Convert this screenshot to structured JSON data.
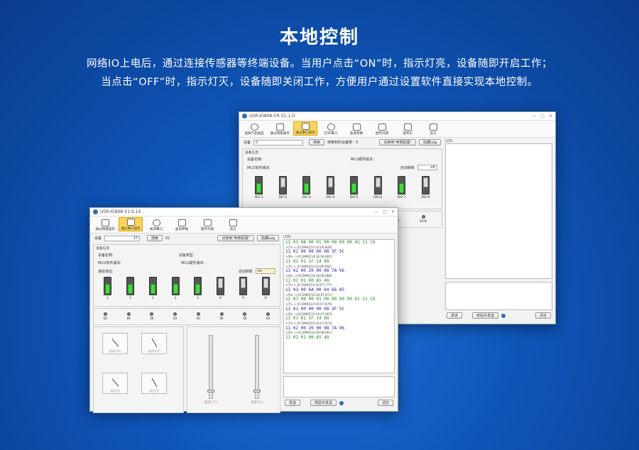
{
  "hero": {
    "title": "本地控制",
    "line1": "网络IO上电后，通过连接传感器等终端设备。当用户点击“ON”时，指示灯亮，设备随即开启工作；",
    "line2": "当点击“OFF”时，指示灯灭，设备随即关闭工作，方便用户通过设置软件直接实现本地控制。"
  },
  "back_window": {
    "title": "USR-IO808-CR V1.1.0",
    "toolbar": [
      {
        "label": "选择产品类型",
        "icon": "disc-icon"
      },
      {
        "label": "通过网络操作",
        "icon": "network-icon"
      },
      {
        "label": "通过串口操作",
        "icon": "serial-port-icon",
        "active": true
      },
      {
        "label": "打开串口",
        "icon": "plug-icon"
      },
      {
        "label": "查询参数",
        "icon": "query-icon"
      },
      {
        "label": "固件升级",
        "icon": "rocket-icon"
      },
      {
        "label": "透传云",
        "icon": "cloud-icon"
      },
      {
        "label": "语言",
        "icon": "globe-icon"
      }
    ],
    "device_label": "设备",
    "device_value": "0",
    "search_label": "搜索",
    "found_label": "搜索到的设备数：0",
    "switch_button": "切换到\"参数配置\"",
    "hide_log_button": "隐藏Log",
    "info_group": "设备信息",
    "device_name_label": "设备名称:",
    "mcu_label": "MCU硬件版本:",
    "mcu_fw_label": "MCU软件版本:",
    "auto_refresh_label": "自动刷新",
    "auto_refresh_value": "off",
    "relays": [
      {
        "label": "DO-1",
        "state": "on"
      },
      {
        "label": "DO-2",
        "state": "off"
      },
      {
        "label": "DO-3",
        "state": "on"
      },
      {
        "label": "DO-4",
        "state": "off"
      },
      {
        "label": "DO-5",
        "state": "on"
      },
      {
        "label": "DO-6",
        "state": "off"
      },
      {
        "label": "DO-7",
        "state": "on"
      },
      {
        "label": "DO-8",
        "state": "off"
      }
    ],
    "di_visible": [
      "DI-7",
      "DI-8"
    ],
    "log_title": "LOG",
    "send_button": "发送",
    "verify_send_button": "校验并发送",
    "clear_button": "清空"
  },
  "front_window": {
    "title": "USR-IO808 V1.0.14",
    "toolbar": [
      {
        "label": "通过网络操作",
        "icon": "network-icon"
      },
      {
        "label": "通过串口操作",
        "icon": "serial-port-icon",
        "active": true
      },
      {
        "label": "关闭串口",
        "icon": "check-icon"
      },
      {
        "label": "查询参数",
        "icon": "query-icon"
      },
      {
        "label": "固件升级",
        "icon": "rocket-icon"
      },
      {
        "label": "语言",
        "icon": "globe-icon"
      }
    ],
    "device_label": "设备",
    "device_value": "17",
    "search_label": "搜索",
    "found_value": "01",
    "switch_button": "切换到\"参数配置\"",
    "hide_log_button": "隐藏Log",
    "info_group": "设备信息",
    "device_name_label": "设备名称:",
    "device_type_label": "设备类型:",
    "mcu_fw_label": "MCU软件版本:",
    "mcu_hw_label": "MCU硬件版本:",
    "comm_addr_label": "通信地址:",
    "auto_refresh_label": "自动刷新",
    "auto_refresh_value": "on",
    "relays": [
      {
        "label": "1",
        "state": "on"
      },
      {
        "label": "1",
        "state": "on"
      },
      {
        "label": "1",
        "state": "on"
      },
      {
        "label": "1",
        "state": "on"
      },
      {
        "label": "1",
        "state": "on"
      },
      {
        "label": "0",
        "state": "off"
      },
      {
        "label": "0",
        "state": "off"
      },
      {
        "label": "0",
        "state": "off"
      }
    ],
    "di_labels": [
      "DI",
      "DI",
      "DI",
      "DI",
      "DI",
      "DI",
      "DI",
      "DI"
    ],
    "gauges": [
      "电流(mA)",
      "电流(mA)",
      "电压(V)",
      "电压(V)"
    ],
    "slider_labels": [
      "温度(°C)",
      "湿度(%)"
    ],
    "log_title": "LOG",
    "log_lines": [
      {
        "kind": "rx",
        "text": "11 03 08 00 01 00 00 00 00 01 11 C6"
      },
      {
        "kind": "meta",
        "text": ">[Tx <-][COM6][10:16:06:808]"
      },
      {
        "kind": "tx",
        "text": "11 01 00 00 00 08 3F 5C"
      },
      {
        "kind": "meta",
        "text": ">[Rx ->][COM6][10:16:06:895]"
      },
      {
        "kind": "rx",
        "text": "11 01 01 1F 14 80"
      },
      {
        "kind": "meta",
        "text": ">[Tx <-][COM6][10:16:06:902]"
      },
      {
        "kind": "tx",
        "text": "11 02 00 20 00 08 7A 96"
      },
      {
        "kind": "meta",
        "text": ">[Rx ->][COM6][10:16:06:988]"
      },
      {
        "kind": "rx",
        "text": "11 02 01 00 A5 48"
      },
      {
        "kind": "meta",
        "text": ">[Tx <-][COM6][10:16:07:777]"
      },
      {
        "kind": "tx",
        "text": "11 03 00 6A 00 04 66 85"
      },
      {
        "kind": "meta",
        "text": ">[Rx ->][COM6][10:16:07:871]"
      },
      {
        "kind": "rx",
        "text": "11 03 08 00 01 00 00 00 00 01 11 C6"
      },
      {
        "kind": "meta",
        "text": ">[Tx <-][COM6][10:16:07:879]"
      },
      {
        "kind": "tx",
        "text": "11 01 00 00 00 08 3F 5C"
      },
      {
        "kind": "meta",
        "text": ">[Rx ->][COM6][10:16:07:965]"
      },
      {
        "kind": "rx",
        "text": "11 01 01 1F 14 80"
      },
      {
        "kind": "meta",
        "text": ">[Tx <-][COM6][10:16:07:973]"
      },
      {
        "kind": "tx",
        "text": "11 02 00 20 00 08 7A 96"
      },
      {
        "kind": "meta",
        "text": ">[Rx ->][COM6][10:16:08:061]"
      },
      {
        "kind": "rx",
        "text": "11 02 01 00 A5 48"
      }
    ],
    "send_button": "发送",
    "verify_send_button": "校验并发送",
    "clear_button": "清空"
  },
  "colors": {
    "accent": "#f9d45a",
    "on": "#49d649",
    "tx": "#1a1aa8",
    "rx": "#1a8a1a"
  }
}
